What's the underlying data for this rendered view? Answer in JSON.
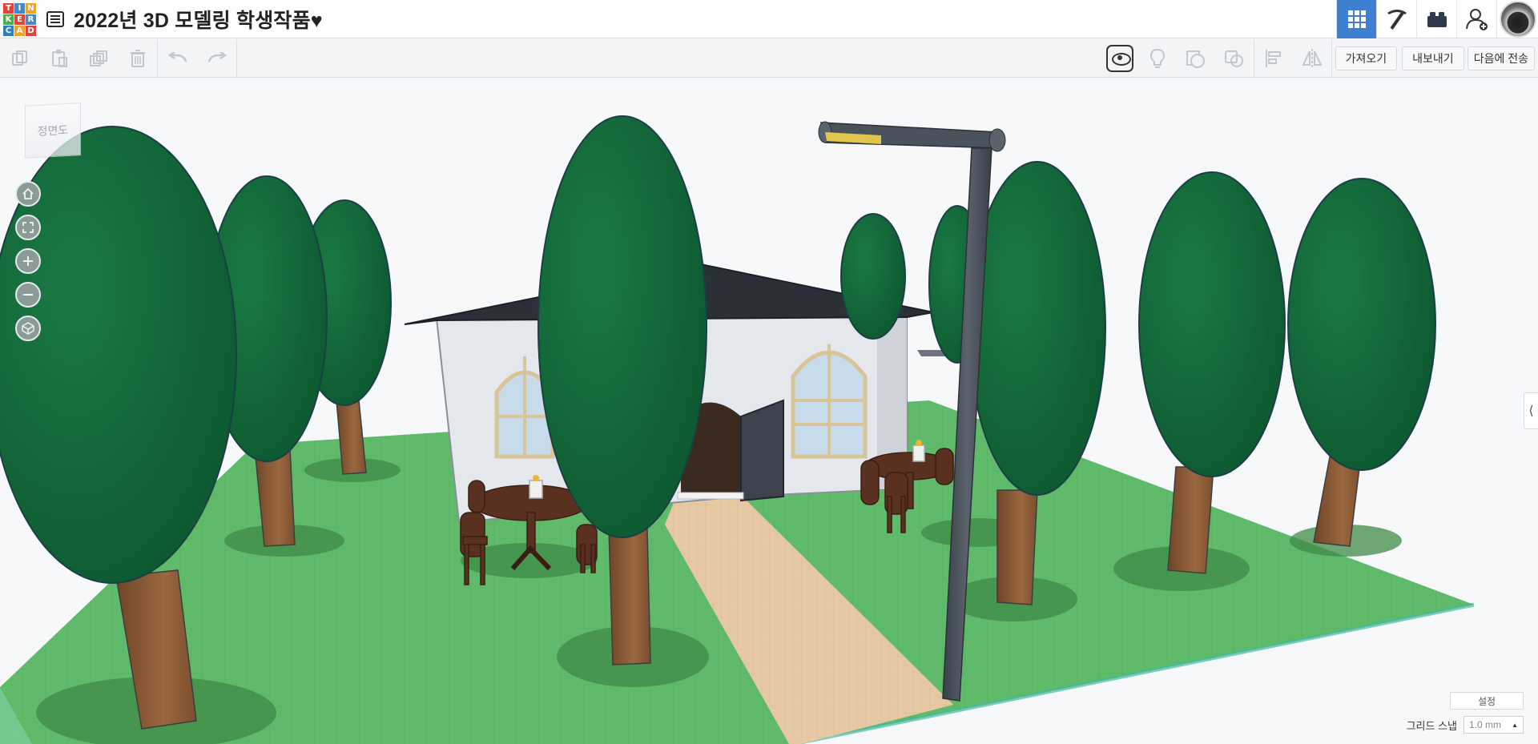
{
  "logo": {
    "letters": [
      "T",
      "I",
      "N",
      "K",
      "E",
      "R",
      "C",
      "A",
      "D"
    ]
  },
  "header": {
    "design_title": "2022년 3D 모델링 학생작품♥",
    "design_list_icon": "list-icon",
    "right_buttons": [
      {
        "name": "3d-design-view",
        "icon": "grid-icon",
        "active": true
      },
      {
        "name": "minecraft-view",
        "icon": "pickaxe-icon",
        "active": false
      },
      {
        "name": "brick-view",
        "icon": "brick-icon",
        "active": false
      },
      {
        "name": "add-user",
        "icon": "add-user-icon",
        "active": false
      }
    ],
    "accent_color": "#3e7fd0"
  },
  "toolbar": {
    "left_icons": [
      "copy-icon",
      "paste-icon",
      "duplicate-icon",
      "delete-icon",
      "undo-icon",
      "redo-icon"
    ],
    "right_icons": [
      "view-icon",
      "light-icon",
      "shape-icon",
      "group-icon",
      "align-icon",
      "mirror-icon"
    ],
    "import_label": "가져오기",
    "export_label": "내보내기",
    "send_label": "다음에 전송"
  },
  "viewcube": {
    "face_label": "정면도"
  },
  "nav_controls": [
    "home-icon",
    "fit-icon",
    "zoom-in-icon",
    "zoom-out-icon",
    "perspective-icon"
  ],
  "bottom_right": {
    "settings_label": "설정",
    "grid_snap_label": "그리드 스냅",
    "grid_snap_value": "1.0 mm"
  },
  "scene_colors": {
    "grass": "#5fbb6a",
    "tree_leaf": "#136b3a",
    "trunk": "#8d5e3a",
    "house_wall": "#e4e7eb",
    "roof": "#2b3038",
    "path": "#e6c9a3",
    "lamp": "#4a525c",
    "furniture": "#5a3020"
  }
}
